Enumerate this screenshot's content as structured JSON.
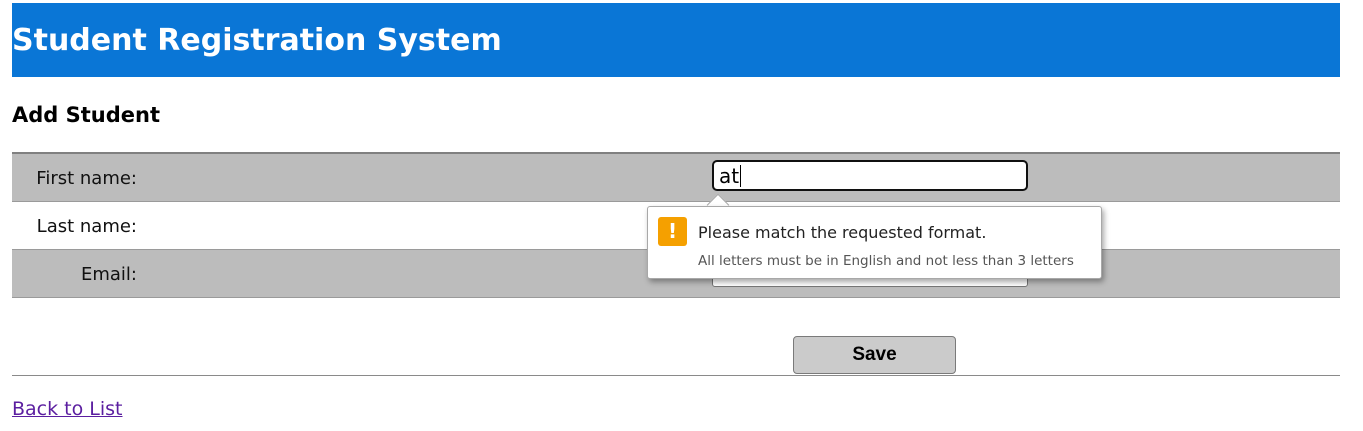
{
  "header": {
    "title": "Student Registration System",
    "background_color": "#0a76d6"
  },
  "page": {
    "heading": "Add Student"
  },
  "form": {
    "first_name": {
      "label": "First name:",
      "value": "at",
      "focused": true
    },
    "last_name": {
      "label": "Last name:",
      "value": ""
    },
    "email": {
      "label": "Email:",
      "value": ""
    },
    "save_label": "Save"
  },
  "validation": {
    "icon": "warning-icon",
    "icon_glyph": "!",
    "icon_color": "#f5a000",
    "title": "Please match the requested format.",
    "detail": "All letters must be in English and not less than 3 letters"
  },
  "footer": {
    "back_link": "Back to List"
  }
}
